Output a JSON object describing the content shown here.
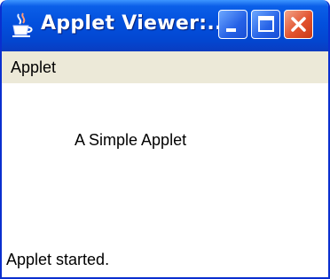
{
  "window": {
    "title": "Applet Viewer:...",
    "menu_label": "Applet",
    "status": "Applet started."
  },
  "applet": {
    "text": "A Simple Applet"
  },
  "icons": {
    "app": "java-cup-icon",
    "minimize": "minimize-icon",
    "maximize": "maximize-icon",
    "close": "close-icon"
  },
  "colors": {
    "titlebar": "#0350dd",
    "menu_bg": "#ece9d8",
    "close_button": "#e2532f",
    "content_bg": "#ffffff"
  }
}
